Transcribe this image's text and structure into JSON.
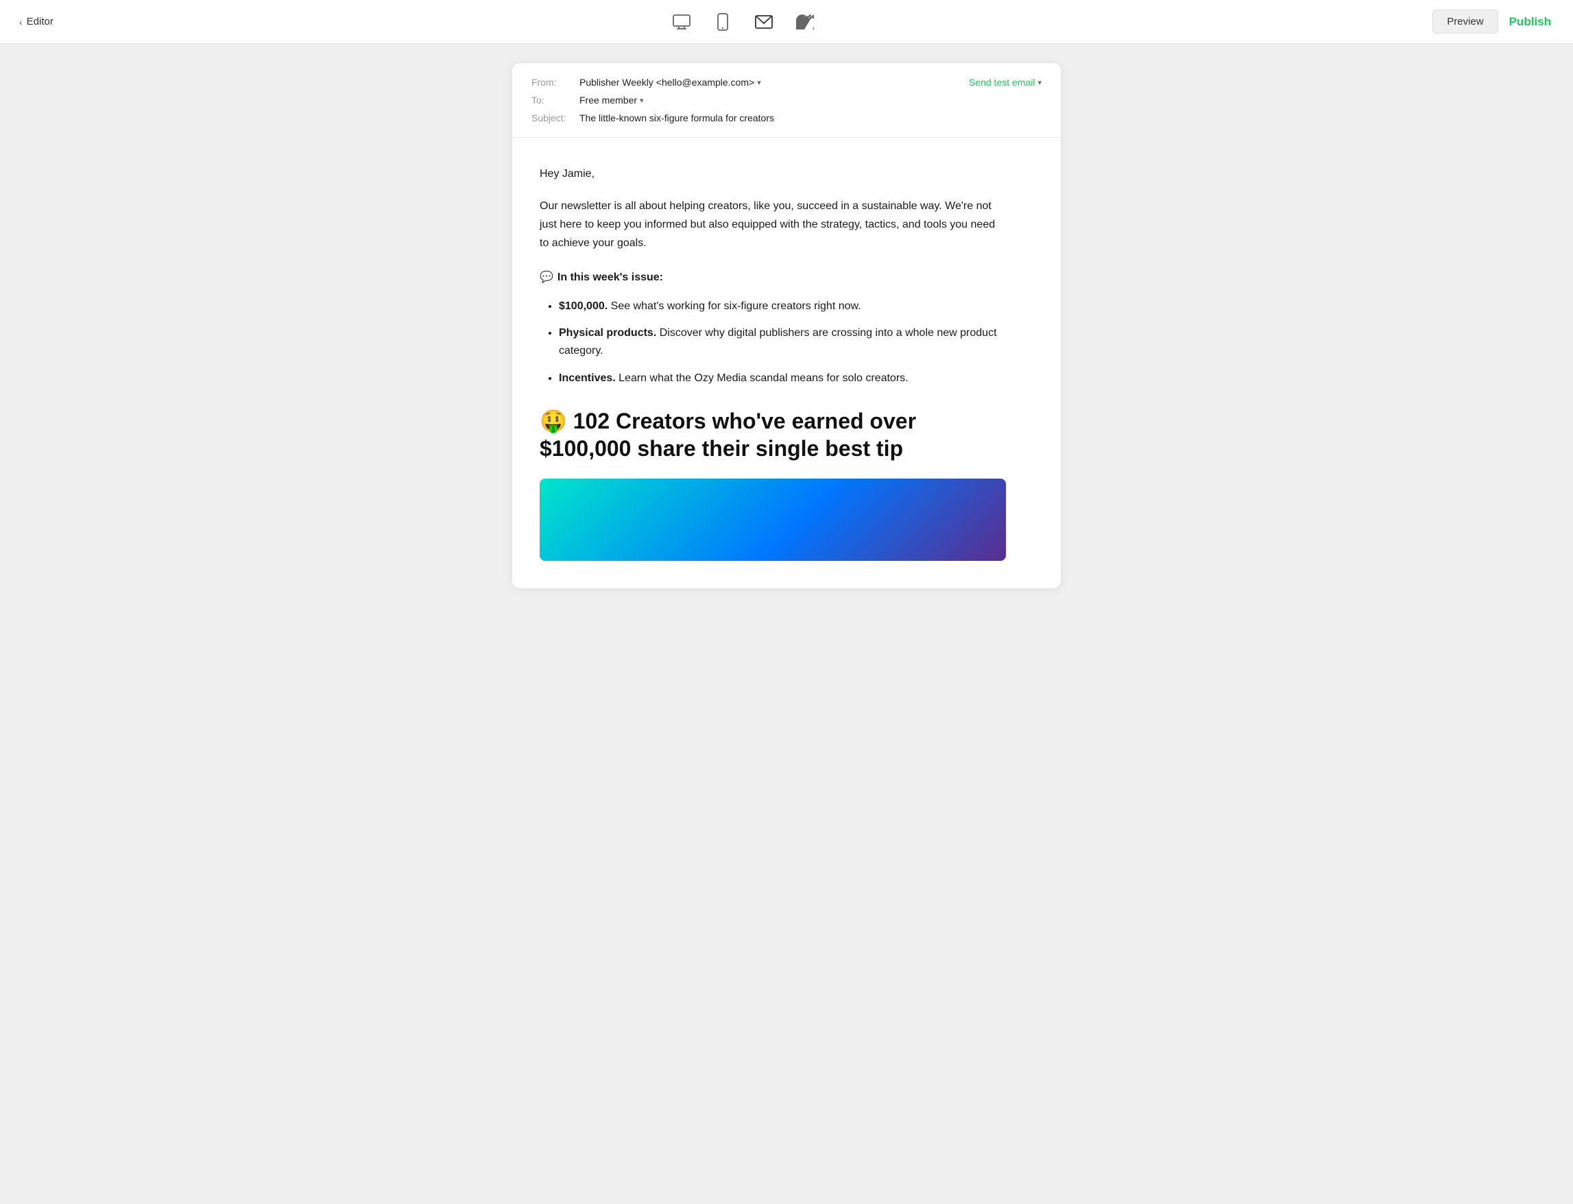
{
  "topbar": {
    "back_label": "Editor",
    "preview_label": "Preview",
    "publish_label": "Publish"
  },
  "icons": {
    "desktop": "🖥",
    "mobile": "📱",
    "email": "✉",
    "twitter": "𝕏"
  },
  "email_header": {
    "from_label": "From:",
    "from_value": "Publisher Weekly <hello@example.com>",
    "to_label": "To:",
    "to_value": "Free member",
    "subject_label": "Subject:",
    "subject_value": "The little-known six-figure formula for creators",
    "send_test_label": "Send test email"
  },
  "email_body": {
    "greeting": "Hey Jamie,",
    "intro": "Our newsletter is all about helping creators, like you, succeed in a sustainable way. We're not just here to keep you informed but also equipped with the strategy, tactics, and tools you need to achieve your goals.",
    "section_emoji": "💬",
    "section_heading": "In this week's issue:",
    "list_items": [
      {
        "bold": "$100,000.",
        "text": " See what's working for six-figure creators right now."
      },
      {
        "bold": "Physical products.",
        "text": " Discover why digital publishers are crossing into a whole new product category."
      },
      {
        "bold": "Incentives.",
        "text": " Learn what the Ozy Media scandal means for solo creators."
      }
    ],
    "big_heading_emoji": "🤑",
    "big_heading": " 102 Creators who've earned over $100,000 share their single best tip"
  }
}
